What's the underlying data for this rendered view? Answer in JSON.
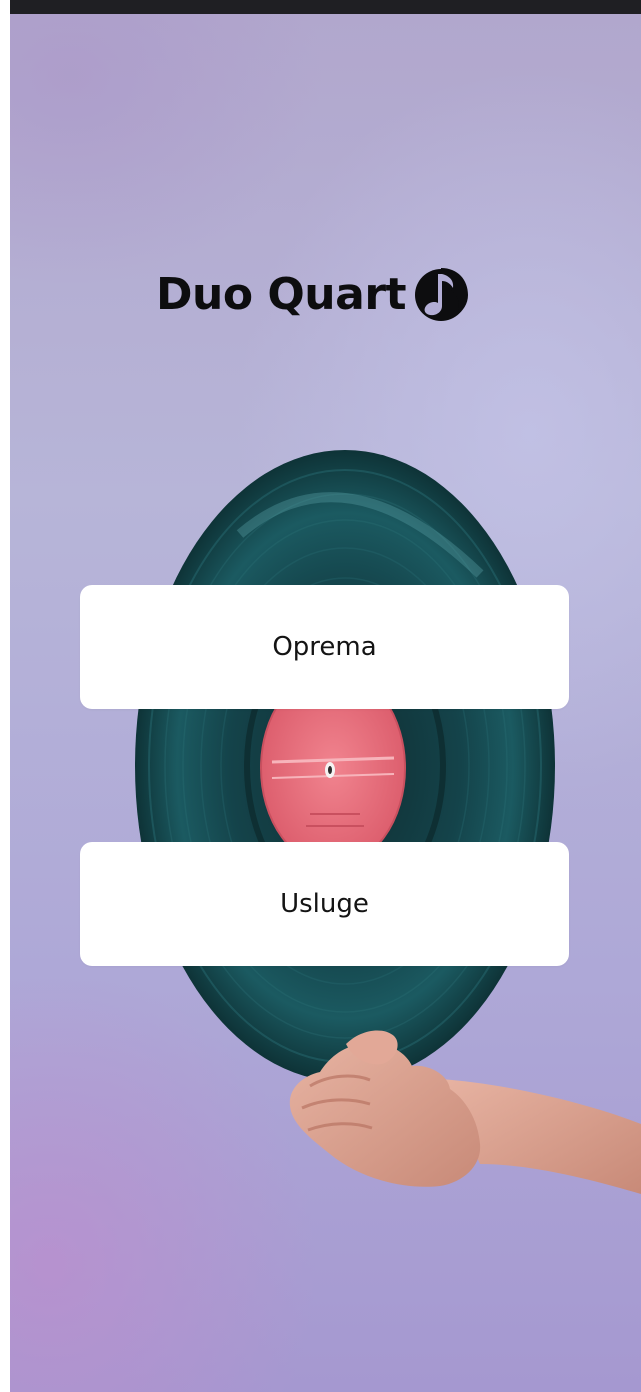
{
  "app": {
    "logo_text": "Duo Quart",
    "logo_icon": "music-note-icon"
  },
  "menu": {
    "items": [
      {
        "label": "Oprema"
      },
      {
        "label": "Usluge"
      }
    ]
  },
  "colors": {
    "background": "#b3aed6",
    "button": "#ffffff",
    "text": "#141414",
    "logo": "#0d0d0f",
    "record_label": "#e9707c",
    "record_vinyl": "#12393d"
  }
}
